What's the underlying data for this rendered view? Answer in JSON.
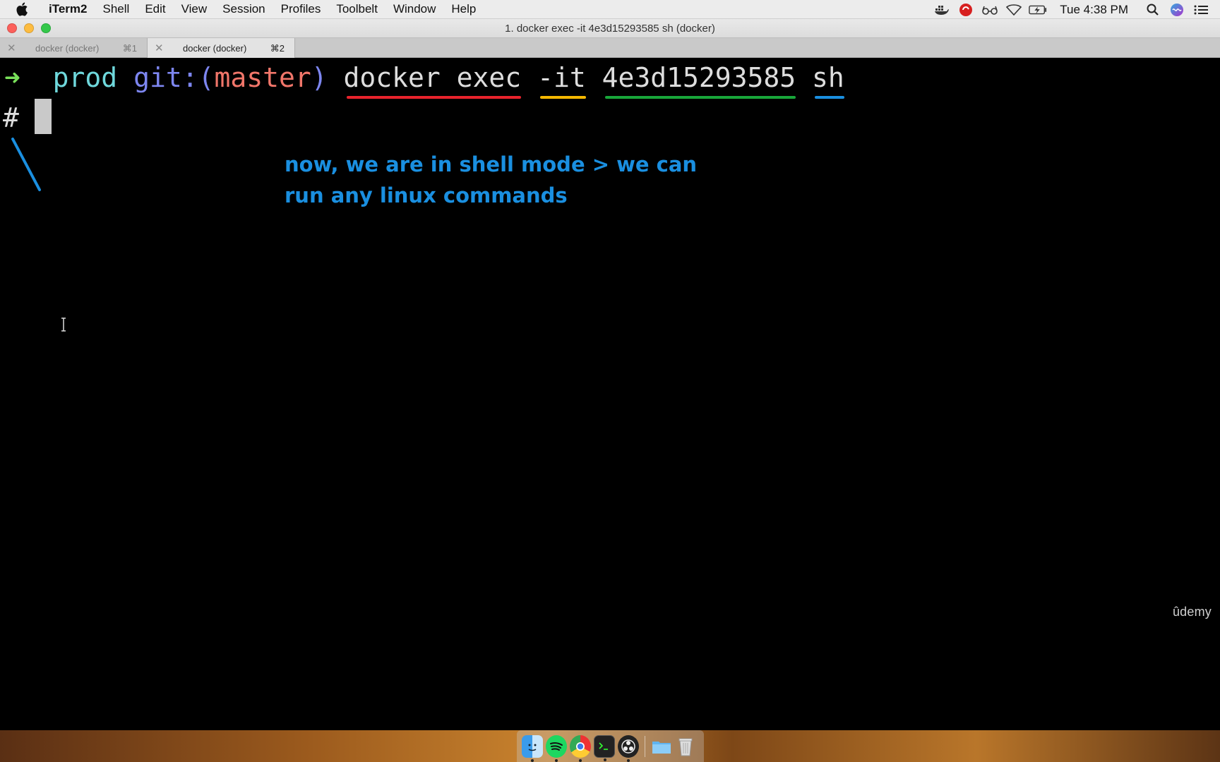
{
  "menubar": {
    "app_name": "iTerm2",
    "items": [
      "Shell",
      "Edit",
      "View",
      "Session",
      "Profiles",
      "Toolbelt",
      "Window",
      "Help"
    ],
    "clock": "Tue 4:38 PM"
  },
  "window": {
    "title": "1. docker exec -it 4e3d15293585 sh (docker)"
  },
  "tabs": [
    {
      "title": "docker (docker)",
      "shortcut": "⌘1",
      "active": false
    },
    {
      "title": "docker (docker)",
      "shortcut": "⌘2",
      "active": true
    }
  ],
  "terminal": {
    "prompt_arrow": "➜",
    "directory": "prod",
    "git_label": "git:(",
    "branch": "master",
    "git_close": ")",
    "command": {
      "part1": "docker exec",
      "part2": "-it",
      "part3": "4e3d15293585",
      "part4": "sh"
    },
    "shell_prompt": "#"
  },
  "annotation": {
    "line1": "now, we are in shell mode > we can",
    "line2": "run any linux commands"
  },
  "watermark": "ûdemy",
  "colors": {
    "annotation": "#1a8fe0",
    "underline_1": "#e8232c",
    "underline_2": "#f5b800",
    "underline_3": "#18a63a",
    "underline_4": "#1a8fe0"
  },
  "dock_icons": [
    "finder-icon",
    "spotify-icon",
    "chrome-icon",
    "terminal-icon",
    "obs-icon",
    "folder-icon",
    "trash-icon"
  ]
}
